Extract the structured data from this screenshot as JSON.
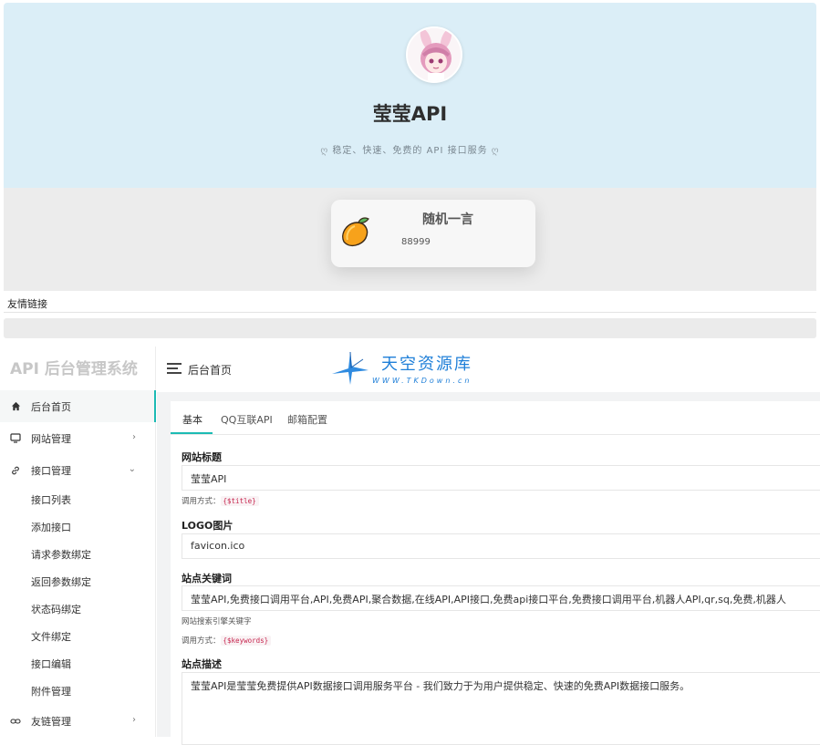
{
  "site": {
    "title": "莹莹API",
    "subtitle": "稳定、快速、免费的 API 接口服务",
    "quote_title": "随机一言",
    "quote_text": "88999",
    "friend_links": "友情链接"
  },
  "admin": {
    "brand": "API 后台管理系统",
    "breadcrumb": "后台首页",
    "watermark_title": "天空资源库",
    "watermark_url": "WWW.TKDown.cn",
    "menu": [
      {
        "label": "后台首页",
        "icon": "home-icon",
        "active": true
      },
      {
        "label": "网站管理",
        "icon": "monitor-icon",
        "caret": "›"
      },
      {
        "label": "接口管理",
        "icon": "link-icon",
        "caret": "⌄"
      }
    ],
    "submenu": [
      "接口列表",
      "添加接口",
      "请求参数绑定",
      "返回参数绑定",
      "状态码绑定",
      "文件绑定",
      "接口编辑",
      "附件管理"
    ],
    "menu_bottom": {
      "label": "友链管理",
      "icon": "link-icon",
      "caret": "›"
    },
    "tabs": [
      "基本",
      "QQ互联API",
      "邮箱配置"
    ],
    "form": {
      "title_label": "网站标题",
      "title_value": "莹莹API",
      "title_hint_prefix": "调用方式：",
      "title_hint_code": "{$title}",
      "logo_label": "LOGO图片",
      "logo_value": "favicon.ico",
      "keywords_label": "站点关键词",
      "keywords_value": "莹莹API,免费接口调用平台,API,免费API,聚合数据,在线API,API接口,免费api接口平台,免费接口调用平台,机器人API,qr,sq,免费,机器人",
      "keywords_hint": "网站搜索引擎关键字",
      "keywords_hint_prefix": "调用方式：",
      "keywords_hint_code": "{$keywords}",
      "desc_label": "站点描述",
      "desc_value": "莹莹API是莹莹免费提供API数据接口调用服务平台 - 我们致力于为用户提供稳定、快速的免费API数据接口服务。"
    }
  },
  "colors": {
    "accent": "#1cbbb4",
    "hero_bg": "#dbeef7",
    "watermark": "#1f7fd8"
  }
}
